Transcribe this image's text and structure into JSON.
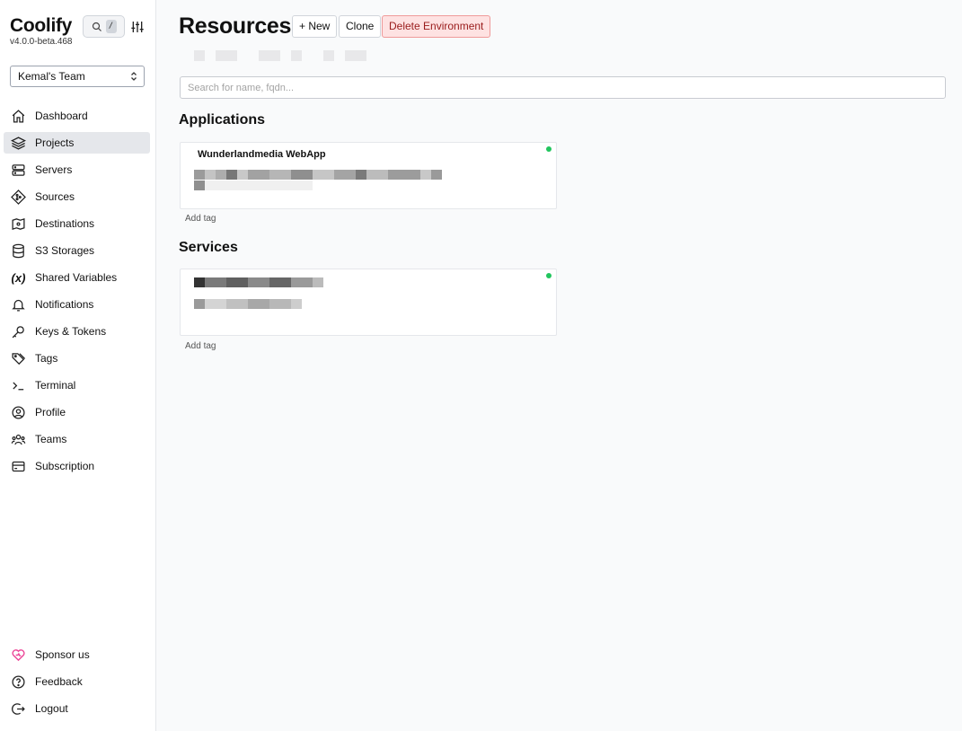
{
  "sidebar": {
    "brand": "Coolify",
    "version": "v4.0.0-beta.468",
    "search_shortcut": "/",
    "team": "Kemal's Team",
    "nav": [
      {
        "label": "Dashboard",
        "icon": "home-icon"
      },
      {
        "label": "Projects",
        "icon": "layers-icon",
        "active": true
      },
      {
        "label": "Servers",
        "icon": "server-icon"
      },
      {
        "label": "Sources",
        "icon": "git-icon"
      },
      {
        "label": "Destinations",
        "icon": "destination-icon"
      },
      {
        "label": "S3 Storages",
        "icon": "database-icon"
      },
      {
        "label": "Shared Variables",
        "icon": "variable-icon"
      },
      {
        "label": "Notifications",
        "icon": "bell-icon"
      },
      {
        "label": "Keys & Tokens",
        "icon": "key-icon"
      },
      {
        "label": "Tags",
        "icon": "tag-icon"
      },
      {
        "label": "Terminal",
        "icon": "terminal-icon"
      },
      {
        "label": "Profile",
        "icon": "user-circle-icon"
      },
      {
        "label": "Teams",
        "icon": "team-icon"
      },
      {
        "label": "Subscription",
        "icon": "credit-card-icon"
      }
    ],
    "bottom": [
      {
        "label": "Sponsor us",
        "icon": "heart-icon"
      },
      {
        "label": "Feedback",
        "icon": "help-circle-icon"
      },
      {
        "label": "Logout",
        "icon": "logout-icon"
      }
    ],
    "sponsor_color": "#ec4899"
  },
  "main": {
    "title": "Resources",
    "buttons": {
      "new": "+ New",
      "clone": "Clone",
      "delete": "Delete Environment"
    },
    "search_placeholder": "Search for name, fqdn...",
    "applications": {
      "heading": "Applications",
      "items": [
        {
          "name": "Wunderlandmedia WebApp",
          "status_color": "#22c55e",
          "add_tag": "Add tag"
        }
      ]
    },
    "services": {
      "heading": "Services",
      "items": [
        {
          "name": "",
          "status_color": "#22c55e",
          "add_tag": "Add tag"
        }
      ]
    }
  }
}
